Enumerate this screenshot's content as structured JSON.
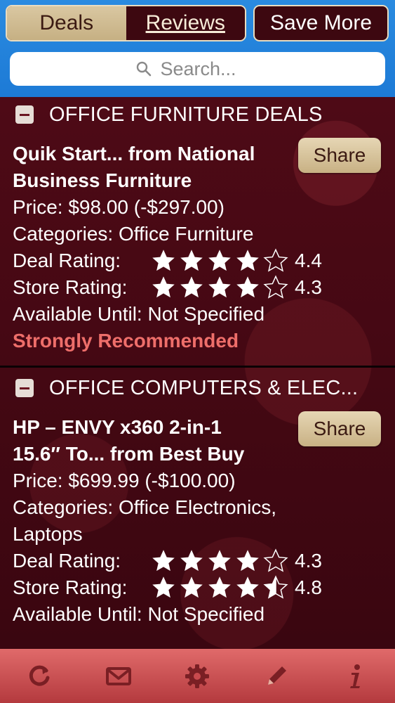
{
  "header": {
    "tabs": [
      {
        "label": "Deals",
        "active": true
      },
      {
        "label": "Reviews",
        "active": false
      }
    ],
    "save_more_label": "Save More"
  },
  "search": {
    "placeholder": "Search..."
  },
  "sections": [
    {
      "title": "OFFICE FURNITURE DEALS",
      "deal": {
        "title": "Quik Start... from National Business Furniture",
        "share_label": "Share",
        "price": "Price: $98.00 (-$297.00)",
        "categories": "Categories: Office Furniture",
        "deal_rating_label": "Deal Rating:",
        "deal_rating_value": "4.4",
        "store_rating_label": "Store Rating:",
        "store_rating_value": "4.3",
        "available": "Available Until: Not Specified",
        "recommendation": "Strongly Recommended"
      }
    },
    {
      "title": "OFFICE COMPUTERS & ELEC...",
      "deal": {
        "title": "HP – ENVY x360 2-in-1 15.6″ To... from Best Buy",
        "share_label": "Share",
        "price": "Price: $699.99 (-$100.00)",
        "categories": "Categories: Office Electronics, Laptops",
        "deal_rating_label": "Deal Rating:",
        "deal_rating_value": "4.3",
        "store_rating_label": "Store Rating:",
        "store_rating_value": "4.8",
        "available": "Available Until: Not Specified"
      }
    }
  ],
  "toolbar": {
    "items": [
      "refresh-icon",
      "mail-icon",
      "gear-icon",
      "pencil-icon",
      "info-icon"
    ]
  },
  "colors": {
    "accent_blue": "#1d7ad6",
    "maroon": "#3a0610",
    "recommend": "#ee6e6a",
    "toolbar": "#c84a4e"
  }
}
